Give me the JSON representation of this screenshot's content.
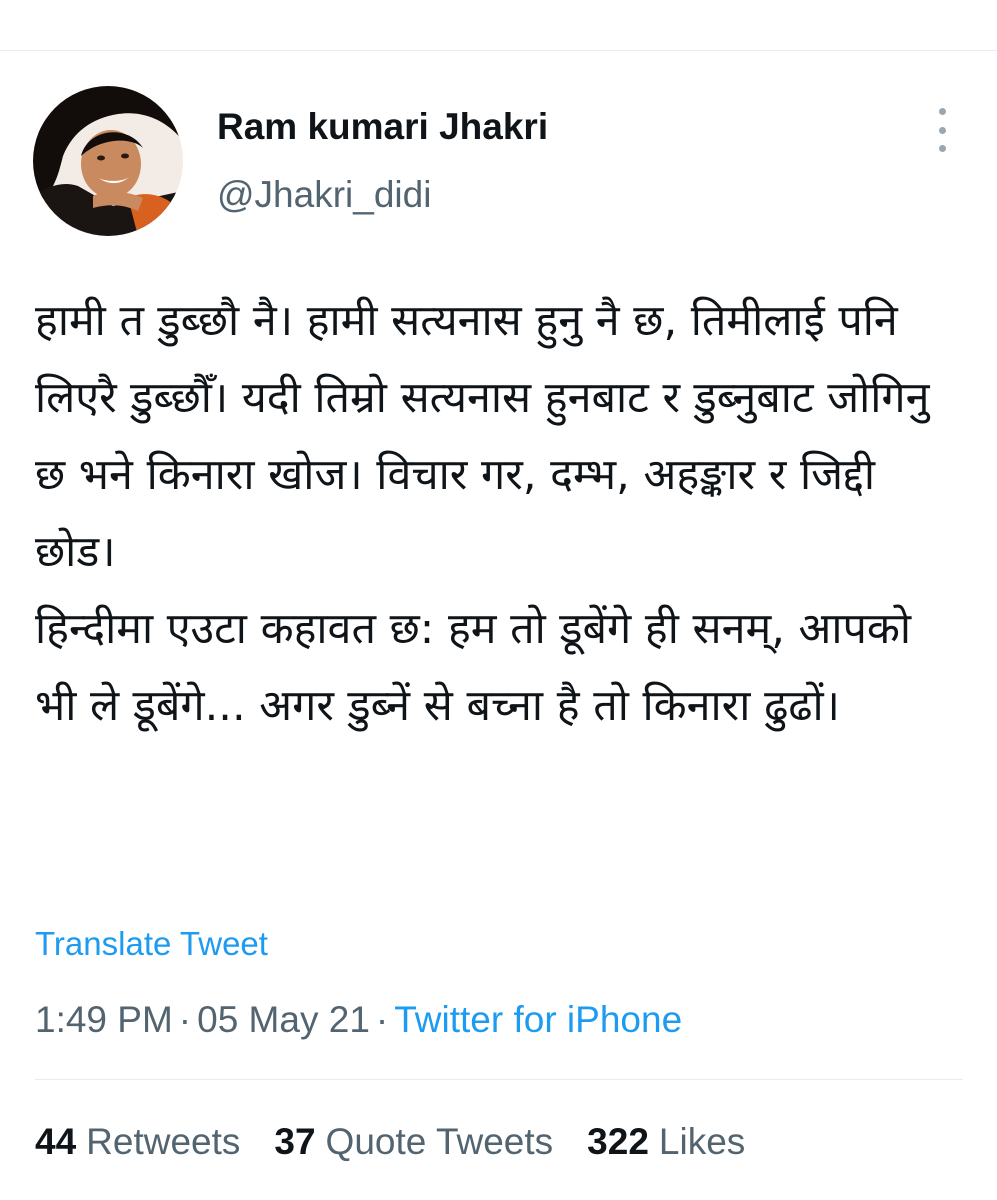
{
  "author": {
    "display_name": "Ram kumari Jhakri",
    "handle": "@Jhakri_didi"
  },
  "tweet": {
    "paragraphs": [
      "हामी त डुब्छौ नै। हामी सत्यनास हुनु नै छ, तिमीलाई पनि लिएरै डुब्छौँ। यदी तिम्रो सत्यनास हुनबाट र डुब्नुबाट जोगिनु छ भने किनारा खोज। विचार गर, दम्भ, अहङ्कार र जिद्दी छोड।",
      "हिन्दीमा एउटा कहावत छ: हम तो डूबेंगे ही सनम्, आपको भी ले डूबेंगे... अगर डुब्नें से बच्ना है तो किनारा ढुढों।"
    ],
    "translate_label": "Translate Tweet",
    "time": "1:49 PM",
    "date": "05 May 21",
    "separator": "·",
    "source": "Twitter for iPhone"
  },
  "stats": {
    "retweets_count": "44",
    "retweets_label": "Retweets",
    "quotes_count": "37",
    "quotes_label": "Quote Tweets",
    "likes_count": "322",
    "likes_label": "Likes"
  },
  "colors": {
    "link": "#1d9bf0",
    "secondary_text": "#536471",
    "primary_text": "#0f1419",
    "divider": "#e6ecf0"
  },
  "icons": {
    "menu": "more-vertical-icon"
  }
}
